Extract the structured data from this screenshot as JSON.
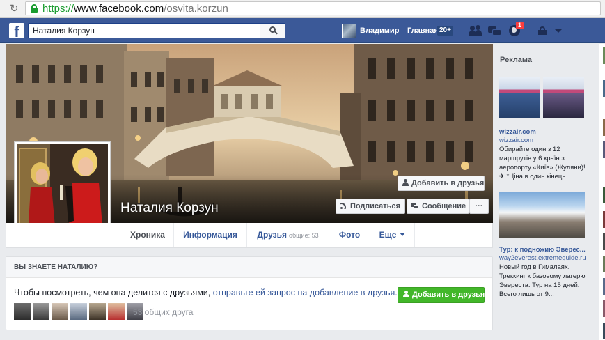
{
  "browser": {
    "url_scheme": "https://",
    "url_host": "www.facebook.com",
    "url_path": "/osvita.korzun"
  },
  "topbar": {
    "logo": "f",
    "search_value": "Наталия Корзун",
    "user_name": "Владимир",
    "home_label": "Главная",
    "home_count": "20+",
    "notifications_count": "1"
  },
  "profile": {
    "name": "Наталия Корзун",
    "add_friend_label": "Добавить в друзья",
    "follow_label": "Подписаться",
    "message_label": "Сообщение",
    "more_label": "···"
  },
  "tabs": [
    {
      "label": "Хроника"
    },
    {
      "label": "Информация"
    },
    {
      "label": "Друзья",
      "count": "общие: 53"
    },
    {
      "label": "Фото"
    },
    {
      "label": "Еще"
    }
  ],
  "know": {
    "heading": "ВЫ ЗНАЕТЕ НАТАЛИЮ?",
    "text_plain": "Чтобы посмотреть, чем она делится с друзьями, ",
    "text_link": "отправьте ей запрос на добавление в друзья.",
    "add_friend_label": "Добавить в друзья",
    "mutual_text": "53 общих друга"
  },
  "ads": {
    "title": "Реклама",
    "ad1": {
      "title": "wizzair.com",
      "domain": "wizzair.com",
      "desc": [
        "Обирайте один з 12",
        "маршрутів у 6 країн з",
        "аеропорту «Київ» (Жуляни)!",
        "✈ *Ціна в один кінець..."
      ]
    },
    "ad2": {
      "title": "Тур: к подножию Эверес...",
      "domain": "way2everest.extremeguide.ru",
      "desc": [
        "Новый год в Гималаях.",
        "Треккинг к базовому лагерю",
        "Эвереста. Тур на 15 дней.",
        "Всего лишь от 9..."
      ]
    }
  },
  "colors": {
    "fb_blue": "#3b5998",
    "link_blue": "#365899",
    "green_button": "#42b72a",
    "badge_red": "#fa3e3e",
    "https_green": "#1a9c2f"
  }
}
